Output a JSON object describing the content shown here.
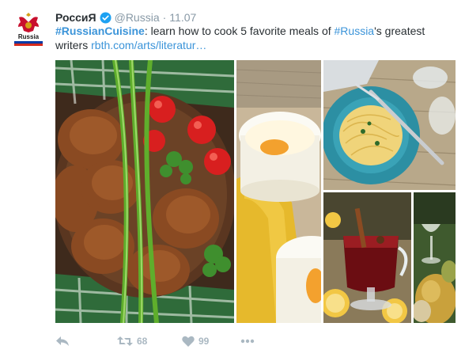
{
  "tweet": {
    "display_name": "РоссиЯ",
    "handle": "@Russia",
    "separator": "·",
    "timestamp": "11.07",
    "avatar_label": "Russia",
    "text_parts": {
      "hashtag1": "#RussianCuisine",
      "middle": ": learn how to cook 5 favorite meals of ",
      "hashtag2": "#Russia",
      "end": "'s greatest writers ",
      "link": "rbth.com/arts/literatur…"
    }
  },
  "actions": {
    "reply_icon": "reply-icon",
    "retweet_icon": "retweet-icon",
    "retweet_count": "68",
    "like_icon": "heart-icon",
    "like_count": "99",
    "more_icon": "more-dots-icon"
  },
  "colors": {
    "link": "#3b94d9",
    "verified": "#1da1f2",
    "muted": "#8899a6",
    "action": "#aab8c2"
  },
  "media": {
    "photos": [
      "cutlets-tomatoes-green-onion-photo",
      "baked-eggs-ramekins-photo",
      "pasta-plate-fork-photo",
      "mulled-wine-glass-photo",
      "pears-wine-glass-photo"
    ]
  }
}
